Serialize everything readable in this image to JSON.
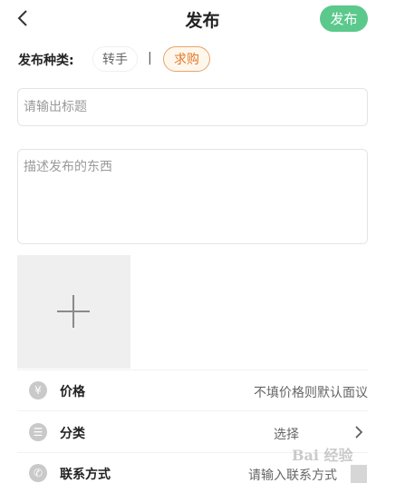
{
  "header": {
    "back_icon": "chevron-left-icon",
    "title": "发布",
    "publish_label": "发布",
    "publish_color": "#5bc98c"
  },
  "type_selector": {
    "label": "发布种类:",
    "options": [
      {
        "label": "转手",
        "selected": false
      },
      {
        "label": "求购",
        "selected": true
      }
    ],
    "separator": "|",
    "selected_color": "#e0782a"
  },
  "title_input": {
    "placeholder": "请输出标题",
    "value": ""
  },
  "description_input": {
    "placeholder": "描述发布的东西",
    "value": ""
  },
  "photo_add": {
    "icon": "plus-icon"
  },
  "rows": {
    "price": {
      "icon": "yen-icon",
      "icon_glyph": "¥",
      "label": "价格",
      "value": "不填价格则默认面议"
    },
    "category": {
      "icon": "category-icon",
      "icon_glyph": "☰",
      "label": "分类",
      "value": "选择"
    },
    "contact": {
      "icon": "phone-icon",
      "icon_glyph": "✆",
      "label": "联系方式",
      "value": "请输入联系方式"
    }
  },
  "watermark": {
    "logo": "baidu-logo"
  }
}
